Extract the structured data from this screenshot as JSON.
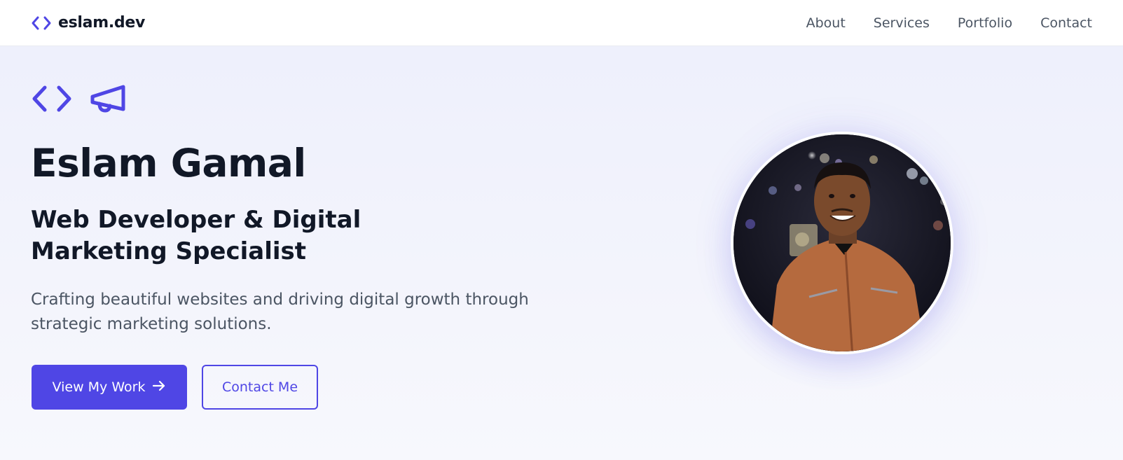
{
  "nav": {
    "brand": "eslam.dev",
    "links": [
      "About",
      "Services",
      "Portfolio",
      "Contact"
    ]
  },
  "hero": {
    "name": "Eslam Gamal",
    "title": "Web Developer & Digital Marketing Specialist",
    "description": "Crafting beautiful websites and driving digital growth through strategic marketing solutions.",
    "primary_button": "View My Work",
    "secondary_button": "Contact Me",
    "icons": [
      "code-icon",
      "megaphone-icon"
    ]
  },
  "colors": {
    "accent": "#4f46e5",
    "text_dark": "#111827",
    "text_muted": "#4b5563",
    "background": "#f3f4fc"
  }
}
